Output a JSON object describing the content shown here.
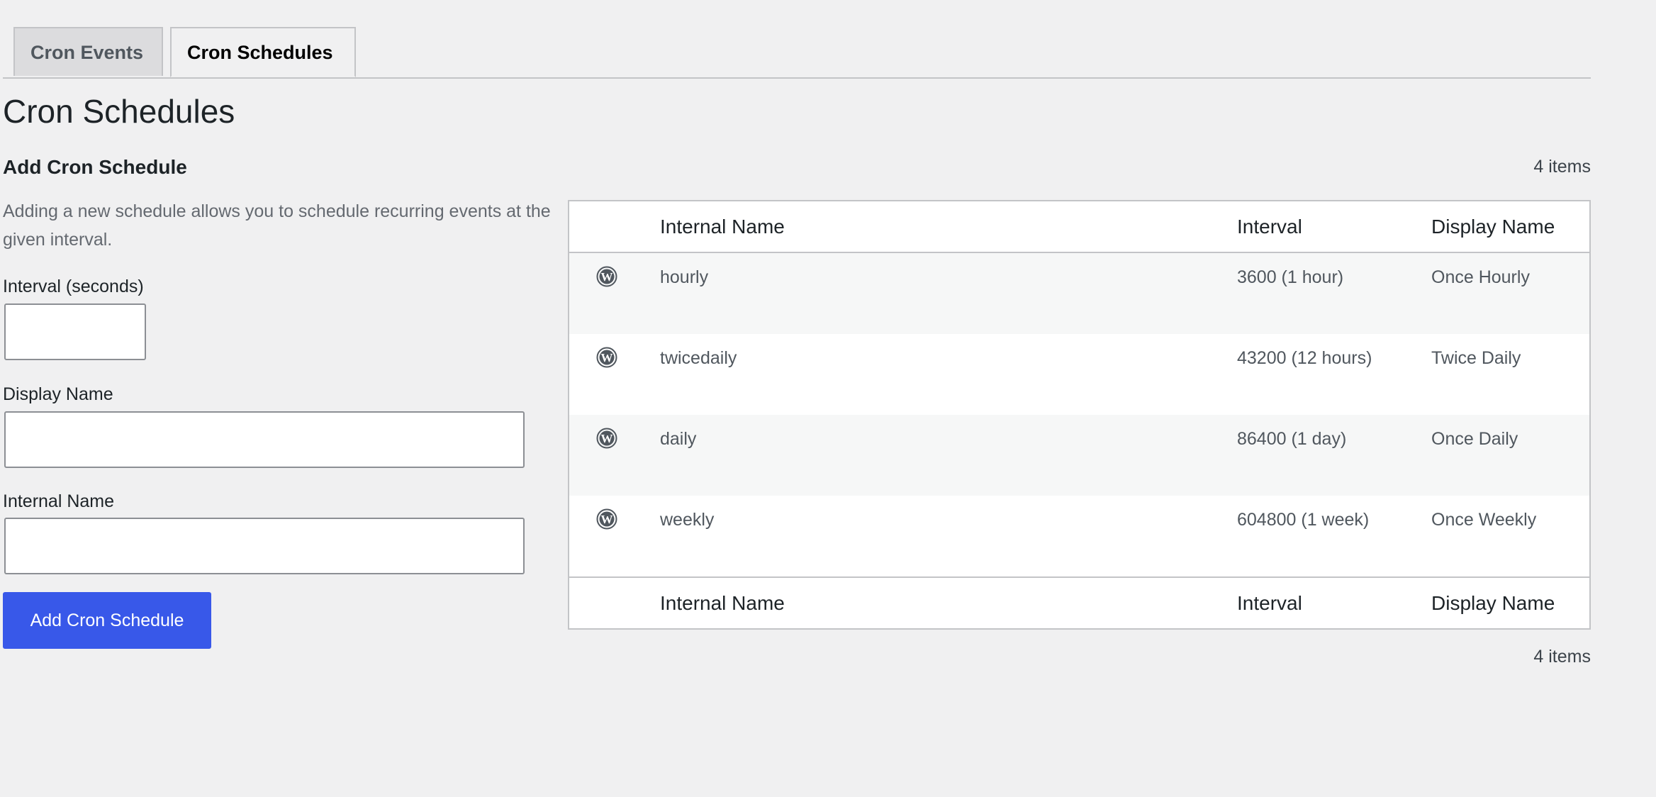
{
  "tabs": [
    {
      "label": "Cron Events",
      "active": false
    },
    {
      "label": "Cron Schedules",
      "active": true
    }
  ],
  "page_title": "Cron Schedules",
  "form": {
    "title": "Add Cron Schedule",
    "description": "Adding a new schedule allows you to schedule recurring events at the given interval.",
    "interval_label": "Interval (seconds)",
    "interval_value": "",
    "display_name_label": "Display Name",
    "display_name_value": "",
    "internal_name_label": "Internal Name",
    "internal_name_value": "",
    "submit_label": "Add Cron Schedule"
  },
  "table": {
    "items_count_top": "4 items",
    "items_count_bottom": "4 items",
    "columns": {
      "internal_name": "Internal Name",
      "interval": "Interval",
      "display_name": "Display Name"
    },
    "rows": [
      {
        "icon": "wordpress-icon",
        "internal_name": "hourly",
        "interval": "3600 (1 hour)",
        "display_name": "Once Hourly"
      },
      {
        "icon": "wordpress-icon",
        "internal_name": "twicedaily",
        "interval": "43200 (12 hours)",
        "display_name": "Twice Daily"
      },
      {
        "icon": "wordpress-icon",
        "internal_name": "daily",
        "interval": "86400 (1 day)",
        "display_name": "Once Daily"
      },
      {
        "icon": "wordpress-icon",
        "internal_name": "weekly",
        "interval": "604800 (1 week)",
        "display_name": "Once Weekly"
      }
    ]
  },
  "colors": {
    "background": "#f0f0f1",
    "primary_button": "#3858e9",
    "border": "#c3c4c7",
    "alt_row": "#f6f7f7"
  }
}
